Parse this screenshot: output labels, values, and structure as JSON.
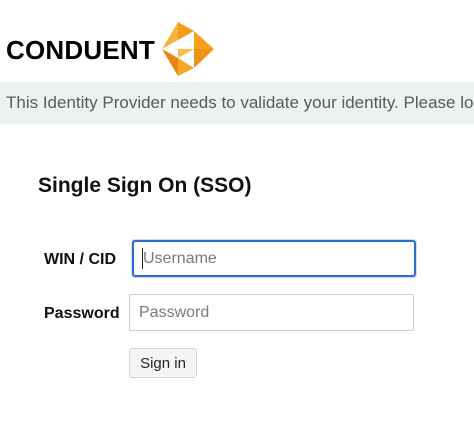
{
  "header": {
    "logo_text": "CONDUENT",
    "logo_mark_icon": "conduent-chevron-logo-icon",
    "brand_color": "#f5a01a"
  },
  "banner": {
    "message": "This Identity Provider needs to validate your identity. Please log in"
  },
  "form": {
    "title": "Single Sign On (SSO)",
    "username": {
      "label": "WIN / CID",
      "placeholder": "Username",
      "value": ""
    },
    "password": {
      "label": "Password",
      "placeholder": "Password",
      "value": ""
    },
    "submit_label": "Sign in",
    "focus_color": "#2d6ed1"
  }
}
